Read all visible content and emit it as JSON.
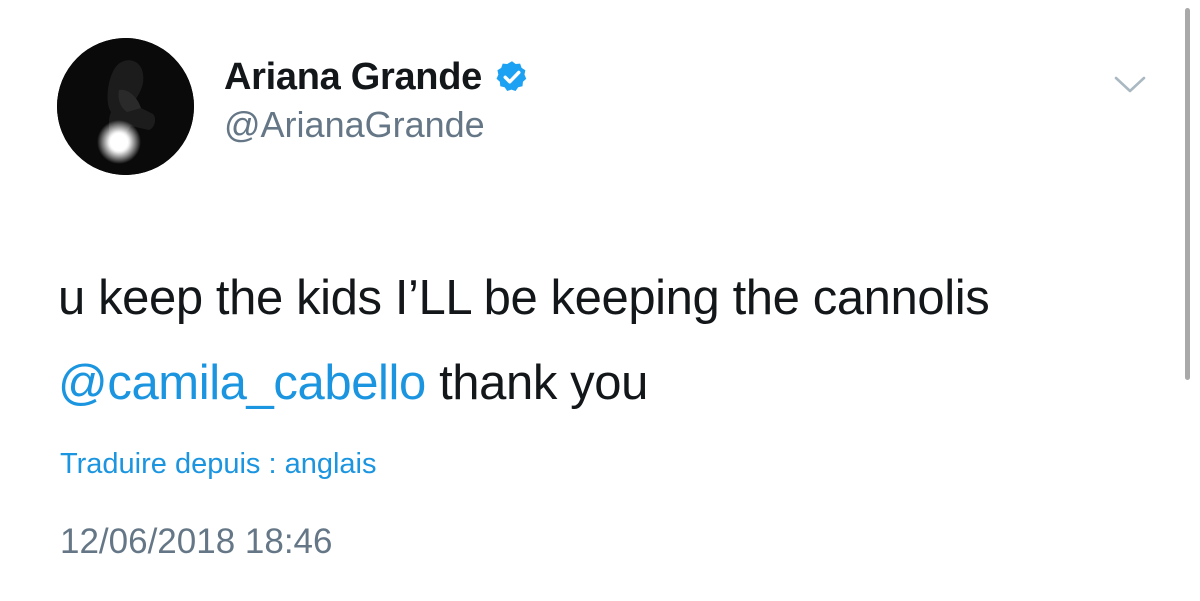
{
  "tweet": {
    "author": {
      "display_name": "Ariana Grande",
      "handle": "@ArianaGrande",
      "verified": true,
      "verified_icon": "verified-badge-icon",
      "avatar_icon": "profile-photo"
    },
    "text": {
      "line1": "u keep the kids I’LL be keeping the cannolis",
      "mention": "@camila_cabello",
      "after_mention": " thank you"
    },
    "translate_label": "Traduire depuis : anglais",
    "timestamp": "12/06/2018 18:46",
    "menu_icon": "chevron-down-icon"
  },
  "colors": {
    "link": "#1b95e0",
    "text": "#14171a",
    "secondary": "#657786",
    "verified": "#1da1f2",
    "chevron": "#aab8c2"
  }
}
